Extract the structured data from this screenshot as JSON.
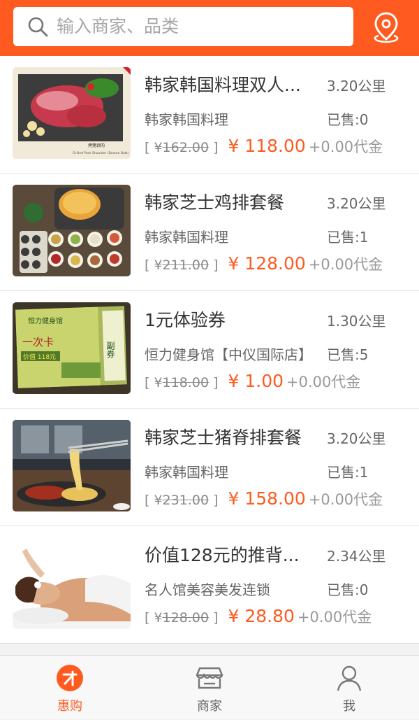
{
  "header": {
    "search_placeholder": "输入商家、品类",
    "accent": "#ff5a1f"
  },
  "deals": [
    {
      "title": "韩家韩国料理双人...",
      "distance": "3.20公里",
      "merchant": "韩家韩国料理",
      "sold": "已售:0",
      "bracket_open": "[ ¥",
      "original_price": "162.00",
      "bracket_close": " ]",
      "price": "¥ 118.00",
      "coin": "+0.00代金",
      "image_caption": "烤猪颈肉",
      "image_caption2": "Grilled Pork Shoulder (Boston Butt)"
    },
    {
      "title": "韩家芝士鸡排套餐",
      "distance": "3.20公里",
      "merchant": "韩家韩国料理",
      "sold": "已售:1",
      "bracket_open": "[ ¥",
      "original_price": "211.00",
      "bracket_close": " ]",
      "price": "¥ 128.00",
      "coin": "+0.00代金"
    },
    {
      "title": "1元体验券",
      "distance": "1.30公里",
      "merchant": "恒力健身馆【中仪国际店】",
      "sold": "已售:5",
      "bracket_open": "[ ¥",
      "original_price": "118.00",
      "bracket_close": " ]",
      "price": "¥ 1.00",
      "coin": "+0.00代金",
      "card_brand": "恒力健身馆",
      "card_name": "一次卡",
      "card_value": "价值 118元",
      "card_side": "副券"
    },
    {
      "title": "韩家芝士猪脊排套餐",
      "distance": "3.20公里",
      "merchant": "韩家韩国料理",
      "sold": "已售:1",
      "bracket_open": "[ ¥",
      "original_price": "231.00",
      "bracket_close": " ]",
      "price": "¥ 158.00",
      "coin": "+0.00代金"
    },
    {
      "title": "价值128元的推背...",
      "distance": "2.34公里",
      "merchant": "名人馆美容美发连锁",
      "sold": "已售:0",
      "bracket_open": "[ ¥",
      "original_price": "128.00",
      "bracket_close": " ]",
      "price": "¥ 28.80",
      "coin": "+0.00代金"
    }
  ],
  "tabbar": {
    "items": [
      {
        "label": "惠购",
        "icon": "deal-icon",
        "active": true
      },
      {
        "label": "商家",
        "icon": "store-icon",
        "active": false
      },
      {
        "label": "我",
        "icon": "user-icon",
        "active": false
      }
    ]
  }
}
